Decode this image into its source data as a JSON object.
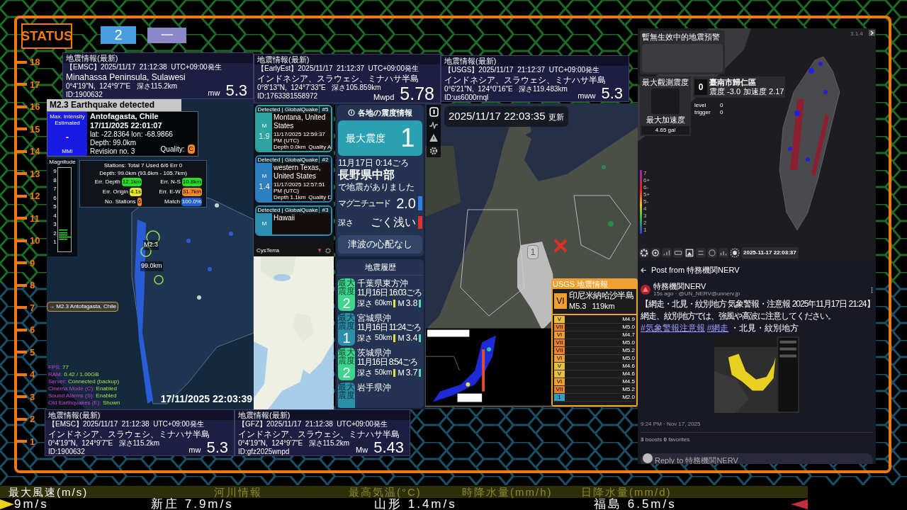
{
  "status": {
    "label": "STATUS",
    "buttons": [
      {
        "label": "2",
        "color": "#4a9ee0"
      },
      {
        "label": "一",
        "color": "#8c88c8"
      }
    ]
  },
  "ruler": [
    "18",
    "17",
    "16",
    "15",
    "14",
    "13",
    "12",
    "11",
    "10",
    "9",
    "8",
    "7",
    "6",
    "5",
    "4",
    "3",
    "2",
    "1"
  ],
  "quake_cards": [
    {
      "header": "地震情報(最新)",
      "lines": [
        "【EMSC】2025/11/17  21:12:38  UTC+09:00発生",
        "Minahassa Peninsula, Sulawesi",
        "0°4'19\"N,  124°9'7\"E   深さ115.2km",
        "ID:1900632"
      ],
      "mag_type": "mw",
      "magnitude": "5.3"
    },
    {
      "header": "地震情報(最新)",
      "lines": [
        "【EarlyEst】2025/11/17  21:12:37  UTC+09:00発生",
        "インドネシア、スラウェシ、ミナハサ半島",
        "0°8'13\"N,  124°7'33\"E   深さ105.859km",
        "ID:1763381558972"
      ],
      "mag_type": "Mwpd",
      "magnitude": "5.78"
    },
    {
      "header": "地震情報(最新)",
      "lines": [
        "【USGS】2025/11/17  21:12:37  UTC+09:00発生",
        "インドネシア、スラウェシ、ミナハサ半島",
        "0°6'21\"N,  124°0'16\"E   深さ119.483km",
        "ID:us6000rnql"
      ],
      "mag_type": "mww",
      "magnitude": "5.3"
    },
    {
      "header": "地震情報(最新)",
      "lines": [
        "【EMSC】2025/11/17  21:12:38  UTC+09:00発生",
        "インドネシア、スラウェシ、ミナハサ半島",
        "0°4'19\"N,  124°9'7\"E   深さ115.2km",
        "ID:1900632"
      ],
      "mag_type": "mw",
      "magnitude": "5.3"
    },
    {
      "header": "地震情報(最新)",
      "lines": [
        "【GFZ】2025/11/17  21:12:38  UTC+09:00発生",
        "インドネシア、スラウェシ、ミナハサ半島",
        "0°4'19\"N,  124°9'7\"E   深さ115.2km",
        "ID:gfz2025wnpd"
      ],
      "mag_type": "Mw",
      "magnitude": "5.43"
    }
  ],
  "globalquake": {
    "title": "M2.3 Earthquake detected",
    "intensity": {
      "caption": "Max. Intensity Estimated",
      "value": "-",
      "unit": "MMI"
    },
    "details": [
      "Antofagasta, Chile",
      "17/11/2025 22:01:07",
      "lat: -22.8364 lon: -68.9866",
      "Depth: 99.0km",
      "Revision no. 3"
    ],
    "quality_label": "Quality:",
    "quality": "C",
    "magnitude_label": "Magnitude",
    "magnitude_scale": [
      "9",
      "8",
      "7",
      "6",
      "5",
      "4",
      "3",
      "2",
      "1"
    ],
    "stats_lines": [
      "Stations: Total 7 Used 6/6 Err 0",
      "Depth: 99.0km (93.6km - 105.7km)"
    ],
    "stats": [
      {
        "label": "Err. Depth",
        "value": "12.1km",
        "color": "#22e022"
      },
      {
        "label": "Err. N-S",
        "value": "10.8km",
        "color": "#22e022"
      },
      {
        "label": "Err. Origin",
        "value": "4.1s",
        "color": "#e8e820"
      },
      {
        "label": "Err. E-W",
        "value": "31.7km",
        "color": "#f08a20"
      },
      {
        "label": "No. Stations",
        "value": "6",
        "color": "#f08a20"
      },
      {
        "label": "Match",
        "value": "100.0%",
        "color": "#2060d0"
      }
    ],
    "map_labels": [
      "M2.3",
      "99.0km"
    ],
    "event_tag": "→ M2.3 Antofagasta, Chile",
    "debug": [
      {
        "label": "FPS:",
        "value": "77"
      },
      {
        "label": "RAM:",
        "value": "0.42 / 1.00GB"
      },
      {
        "label": "Server:",
        "value": "Connected (backup)"
      },
      {
        "label": "Cinema Mode (C):",
        "value": "Enabled"
      },
      {
        "label": "Sound Alarms (S):",
        "value": "Enabled"
      },
      {
        "label": "Old Earthquakes (E):",
        "value": "Shown"
      }
    ],
    "timestamp": "17/11/2025 22:03:39"
  },
  "detections": [
    {
      "source": "Detected | GlobalQuake",
      "number": "#5",
      "m_label": "M",
      "magnitude": "1.9",
      "place": "Montana, United States",
      "time": "11/17/2025 12:59:37 PM (UTC)",
      "depth": "Depth 0.0km",
      "quality": "Quality A",
      "color": "#2fa3a0"
    },
    {
      "source": "Detected | GlobalQuake",
      "number": "#2",
      "m_label": "M",
      "magnitude": "1.4",
      "place": "western Texas, United States",
      "time": "11/17/2025 12:57:51 PM (UTC)",
      "depth": "Depth 1.1km",
      "quality": "Quality D",
      "color": "#2e7fbf"
    },
    {
      "source": "Detected | GlobalQuake",
      "number": "#3",
      "m_label": "M",
      "place": "Hawaii",
      "color": "#2a8fb0"
    }
  ],
  "map_app": {
    "name": "CysTerra"
  },
  "intensity_panel": {
    "title": "各地の震度情報",
    "max_label": "最大震度",
    "max_value": "1",
    "time": "11月17日 0:14ごろ",
    "place": "長野県中部",
    "note": "で地震がありました",
    "magnitude_label": "マグニチュード",
    "magnitude": "2.0",
    "depth_label": "深さ",
    "depth": "ごく浅い",
    "tsunami": "津波の心配なし",
    "history_title": "地震履歴",
    "history": [
      {
        "badge": "最大震度",
        "intensity": "2",
        "place": "千葉県東方沖",
        "time": "11月16日 16:03ごろ",
        "depth_label": "深さ",
        "depth": "60km",
        "m_label": "M",
        "magnitude": "3.8",
        "color": "#3ed68f"
      },
      {
        "badge": "最大震度",
        "intensity": "1",
        "place": "宮城県沖",
        "time": "11月16日 11:24ごろ",
        "depth_label": "深さ",
        "depth": "50km",
        "m_label": "M",
        "magnitude": "3.4",
        "color": "#2b8fa8"
      },
      {
        "badge": "最大震度",
        "intensity": "2",
        "place": "茨城県沖",
        "time": "11月16日 8:54ごろ",
        "depth_label": "深さ",
        "depth": "50km",
        "m_label": "M",
        "magnitude": "3.7",
        "color": "#3ed68f"
      },
      {
        "badge": "最大震度",
        "place": "岩手県沖",
        "color": "#2b8fa8"
      }
    ]
  },
  "japan_map": {
    "updated": "2025/11/17 22:03:35",
    "updated_label": "更新",
    "region_intensity": "1",
    "usgs": {
      "title": "USGS 地震情報",
      "level": "VI",
      "place": "印尼米納哈沙半島",
      "magnitude": "M5.3",
      "depth": "119km",
      "list": [
        {
          "level": "V",
          "magnitude": "M4.9",
          "color": "#e8c040"
        },
        {
          "level": "VII",
          "magnitude": "M5.0",
          "color": "#e88030"
        },
        {
          "level": "VI",
          "magnitude": "M4.7",
          "color": "#f0a030"
        },
        {
          "level": "VII",
          "magnitude": "M5.0",
          "color": "#e88030"
        },
        {
          "level": "VII",
          "magnitude": "M5.2",
          "color": "#e88030"
        },
        {
          "level": "VI",
          "magnitude": "M5.0",
          "color": "#f0a030"
        },
        {
          "level": "V",
          "magnitude": "M4.6",
          "color": "#e8c040"
        },
        {
          "level": "V",
          "magnitude": "M4.6",
          "color": "#e8c040"
        },
        {
          "level": "VI",
          "magnitude": "M4.5",
          "color": "#f0a030"
        },
        {
          "level": "VII",
          "magnitude": "M5.2",
          "color": "#e88030"
        },
        {
          "level": "1",
          "magnitude": "M2.0",
          "color": "#30a0c0"
        }
      ]
    }
  },
  "taiwan": {
    "alert": "暫無生效中的地震預警",
    "version": "3.1.4",
    "max_obs_label": "最大觀測震度",
    "intensity": "0",
    "station": "臺南市歸仁區",
    "readings": [
      "震度 -3.0",
      "加速度 2.17"
    ],
    "status_lines": [
      {
        "label": "level",
        "value": "0"
      },
      {
        "label": "trigger",
        "value": "0"
      }
    ],
    "max_acc_label": "最大加速度",
    "max_acc": "4.65 gal",
    "legend": [
      "7",
      "6+",
      "6-",
      "5+",
      "5-",
      "4",
      "3",
      "2",
      "1"
    ],
    "time": "2025-11-17 22:03:37"
  },
  "post": {
    "header": "Post from 特務機関NERV",
    "author": "特務機関NERV",
    "meta": "15s ago · @UN_NERV@unnerv.jp",
    "lines": [
      "【網走・北見・紋別地方 気象警報・注意報 2025年11月17日 21:24】",
      "網走、紋別地方では、強風や高波に注意してください。"
    ],
    "hashtags": [
      "#気象警報注意報",
      "#網走"
    ],
    "hashtag_suffix": "・北見・紋別地方",
    "time": "9:24 PM · Nov 17, 2025",
    "stats": "**3** boosts **0** favorites",
    "reply_placeholder": "Reply to 特務機関NERV"
  },
  "ticker": {
    "headers": [
      {
        "label": "最大風速(m/s)",
        "selected": true
      },
      {
        "label": "河川情報",
        "selected": false
      },
      {
        "label": "最高気温(°C)",
        "selected": false
      },
      {
        "label": "時降水量(mm/h)",
        "selected": false
      },
      {
        "label": "日降水量(mm/d)",
        "selected": false
      }
    ],
    "values": [
      "9m/s",
      "新庄 7.9m/s",
      "山形 1.4m/s",
      "福島 6.5m/s"
    ]
  }
}
